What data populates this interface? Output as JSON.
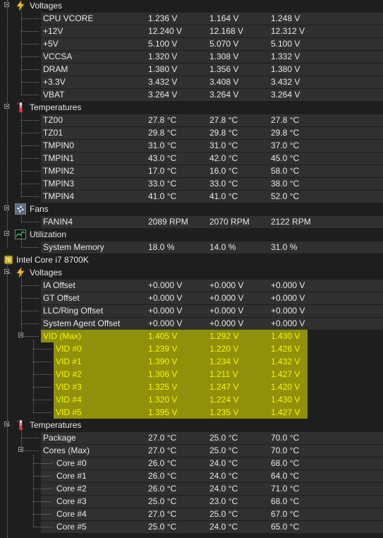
{
  "rows": [
    {
      "kind": "group",
      "icon": "voltage-icon",
      "label": "Voltages"
    },
    {
      "kind": "sensor",
      "label": "CPU VCORE",
      "v": [
        "1.236 V",
        "1.164 V",
        "1.248 V"
      ]
    },
    {
      "kind": "sensor",
      "label": "+12V",
      "v": [
        "12.240 V",
        "12.168 V",
        "12.312 V"
      ]
    },
    {
      "kind": "sensor",
      "label": "+5V",
      "v": [
        "5.100 V",
        "5.070 V",
        "5.100 V"
      ]
    },
    {
      "kind": "sensor",
      "label": "VCCSA",
      "v": [
        "1.320 V",
        "1.308 V",
        "1.332 V"
      ]
    },
    {
      "kind": "sensor",
      "label": "DRAM",
      "v": [
        "1.380 V",
        "1.356 V",
        "1.380 V"
      ]
    },
    {
      "kind": "sensor",
      "label": "+3.3V",
      "v": [
        "3.432 V",
        "3.408 V",
        "3.432 V"
      ]
    },
    {
      "kind": "sensor",
      "label": "VBAT",
      "v": [
        "3.264 V",
        "3.264 V",
        "3.264 V"
      ]
    },
    {
      "kind": "group",
      "icon": "thermometer-icon",
      "label": "Temperatures"
    },
    {
      "kind": "sensor",
      "label": "TZ00",
      "v": [
        "27.8 °C",
        "27.8 °C",
        "27.8 °C"
      ]
    },
    {
      "kind": "sensor",
      "label": "TZ01",
      "v": [
        "29.8 °C",
        "29.8 °C",
        "29.8 °C"
      ]
    },
    {
      "kind": "sensor",
      "label": "TMPIN0",
      "v": [
        "31.0 °C",
        "31.0 °C",
        "37.0 °C"
      ]
    },
    {
      "kind": "sensor",
      "label": "TMPIN1",
      "v": [
        "43.0 °C",
        "42.0 °C",
        "45.0 °C"
      ]
    },
    {
      "kind": "sensor",
      "label": "TMPIN2",
      "v": [
        "17.0 °C",
        "16.0 °C",
        "58.0 °C"
      ]
    },
    {
      "kind": "sensor",
      "label": "TMPIN3",
      "v": [
        "33.0 °C",
        "33.0 °C",
        "38.0 °C"
      ]
    },
    {
      "kind": "sensor",
      "label": "TMPIN4",
      "v": [
        "41.0 °C",
        "41.0 °C",
        "52.0 °C"
      ]
    },
    {
      "kind": "group",
      "icon": "fan-icon",
      "label": "Fans"
    },
    {
      "kind": "sensor",
      "label": "FANIN4",
      "v": [
        "2089 RPM",
        "2070 RPM",
        "2122 RPM"
      ]
    },
    {
      "kind": "group",
      "icon": "utilization-icon",
      "label": "Utilization"
    },
    {
      "kind": "sensor",
      "label": "System Memory",
      "v": [
        "18.0 %",
        "14.0 %",
        "31.0 %"
      ]
    },
    {
      "kind": "device",
      "icon": "cpu-chip-icon",
      "label": "Intel Core i7 8700K"
    },
    {
      "kind": "group",
      "icon": "voltage-icon",
      "label": "Voltages"
    },
    {
      "kind": "sensor",
      "label": "IA Offset",
      "v": [
        "+0.000 V",
        "+0.000 V",
        "+0.000 V"
      ]
    },
    {
      "kind": "sensor",
      "label": "GT Offset",
      "v": [
        "+0.000 V",
        "+0.000 V",
        "+0.000 V"
      ]
    },
    {
      "kind": "sensor",
      "label": "LLC/Ring Offset",
      "v": [
        "+0.000 V",
        "+0.000 V",
        "+0.000 V"
      ]
    },
    {
      "kind": "sensor",
      "label": "System Agent Offset",
      "v": [
        "+0.000 V",
        "+0.000 V",
        "+0.000 V"
      ]
    },
    {
      "kind": "parent",
      "label": "VID (Max)",
      "v": [
        "1.405 V",
        "1.292 V",
        "1.430 V"
      ],
      "hl": true
    },
    {
      "kind": "child",
      "label": "VID #0",
      "v": [
        "1.239 V",
        "1.220 V",
        "1.426 V"
      ],
      "hl": true
    },
    {
      "kind": "child",
      "label": "VID #1",
      "v": [
        "1.390 V",
        "1.234 V",
        "1.432 V"
      ],
      "hl": true
    },
    {
      "kind": "child",
      "label": "VID #2",
      "v": [
        "1.306 V",
        "1.211 V",
        "1.427 V"
      ],
      "hl": true
    },
    {
      "kind": "child",
      "label": "VID #3",
      "v": [
        "1.325 V",
        "1.247 V",
        "1.420 V"
      ],
      "hl": true
    },
    {
      "kind": "child",
      "label": "VID #4",
      "v": [
        "1.320 V",
        "1.224 V",
        "1.430 V"
      ],
      "hl": true
    },
    {
      "kind": "child",
      "label": "VID #5",
      "v": [
        "1.395 V",
        "1.235 V",
        "1.427 V"
      ],
      "hl": true
    },
    {
      "kind": "group",
      "icon": "thermometer-icon",
      "label": "Temperatures"
    },
    {
      "kind": "sensor",
      "label": "Package",
      "v": [
        "27.0 °C",
        "25.0 °C",
        "70.0 °C"
      ]
    },
    {
      "kind": "parent",
      "label": "Cores (Max)",
      "v": [
        "27.0 °C",
        "25.0 °C",
        "70.0 °C"
      ]
    },
    {
      "kind": "child",
      "label": "Core #0",
      "v": [
        "26.0 °C",
        "24.0 °C",
        "68.0 °C"
      ]
    },
    {
      "kind": "child",
      "label": "Core #1",
      "v": [
        "26.0 °C",
        "24.0 °C",
        "64.0 °C"
      ]
    },
    {
      "kind": "child",
      "label": "Core #2",
      "v": [
        "26.0 °C",
        "24.0 °C",
        "71.0 °C"
      ]
    },
    {
      "kind": "child",
      "label": "Core #3",
      "v": [
        "25.0 °C",
        "23.0 °C",
        "68.0 °C"
      ]
    },
    {
      "kind": "child",
      "label": "Core #4",
      "v": [
        "27.0 °C",
        "25.0 °C",
        "67.0 °C"
      ]
    },
    {
      "kind": "child",
      "label": "Core #5",
      "v": [
        "25.0 °C",
        "24.0 °C",
        "65.0 °C"
      ]
    }
  ],
  "colors": {
    "highlight": "#d2d200",
    "text": "#e8e8e8",
    "highlight_text": "#f7f700",
    "stripe": "#303030",
    "background": "#1e1e1e"
  }
}
